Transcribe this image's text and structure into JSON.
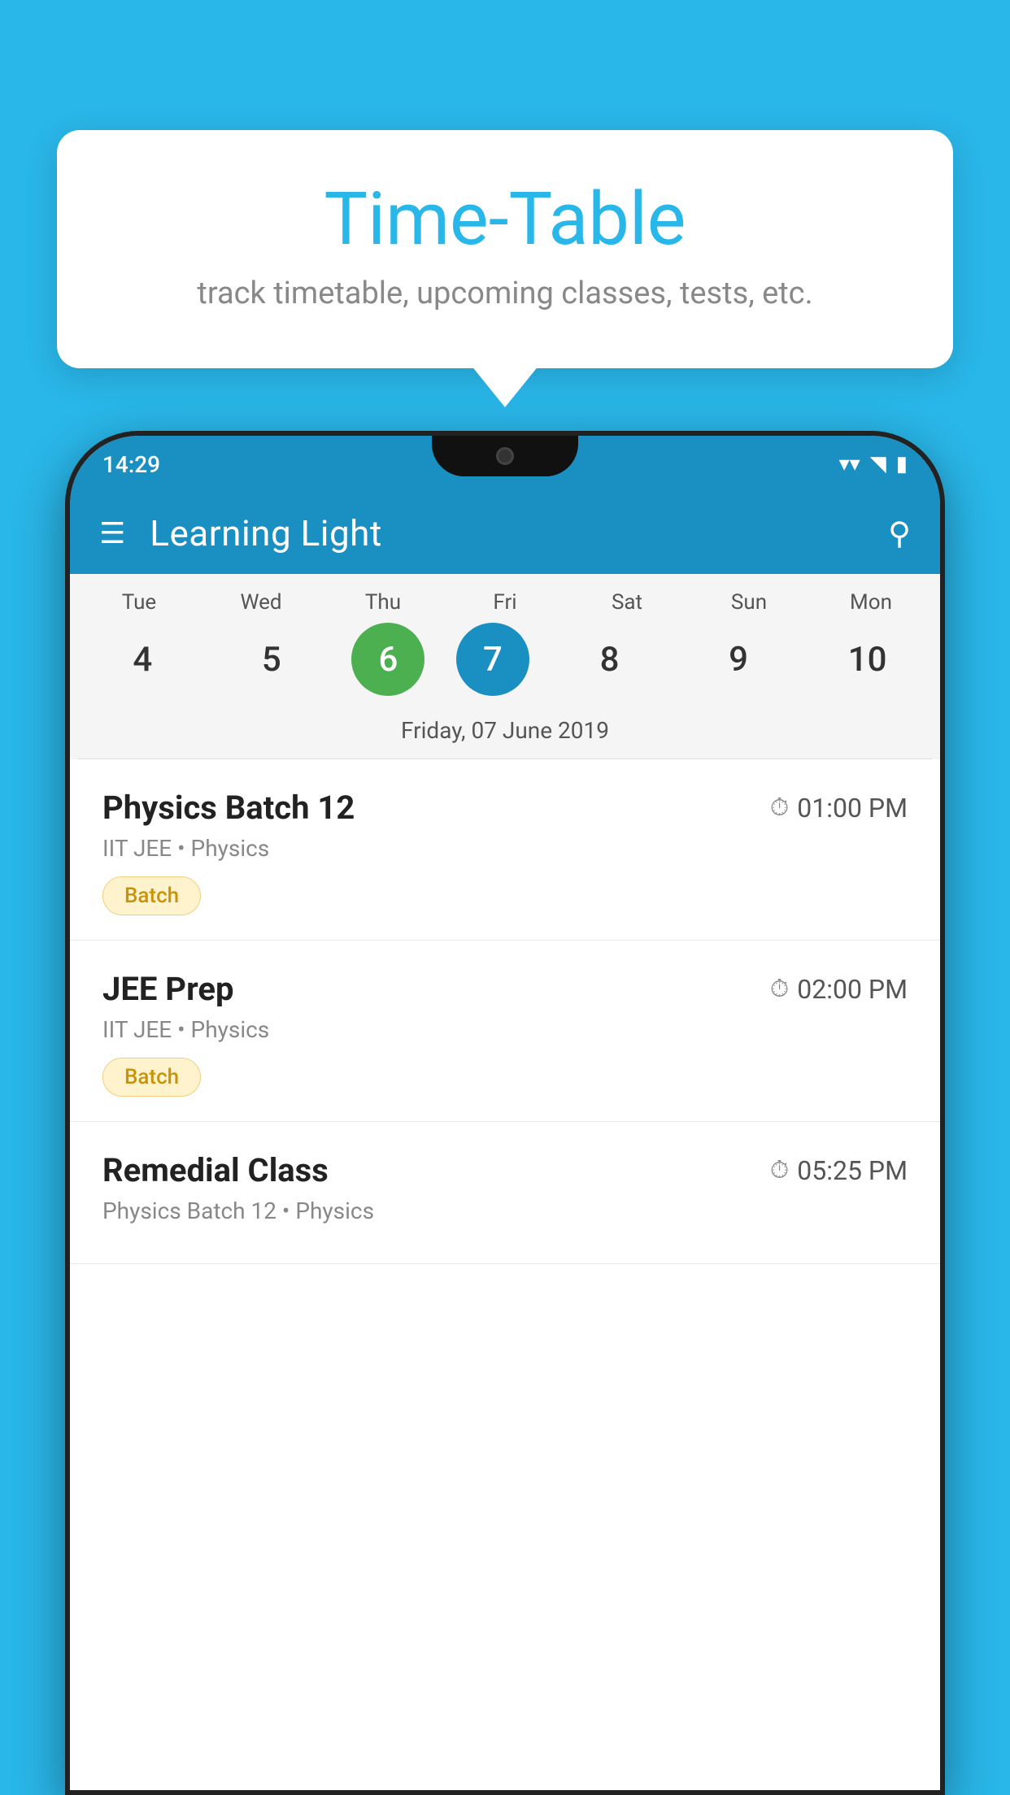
{
  "background_color": "#29b6e8",
  "tooltip": {
    "title": "Time-Table",
    "subtitle": "track timetable, upcoming classes, tests, etc."
  },
  "status_bar": {
    "time": "14:29"
  },
  "app_bar": {
    "title": "Learning Light",
    "hamburger_label": "≡",
    "search_label": "🔍"
  },
  "calendar": {
    "days": [
      {
        "label": "Tue",
        "number": "4"
      },
      {
        "label": "Wed",
        "number": "5"
      },
      {
        "label": "Thu",
        "number": "6",
        "state": "today"
      },
      {
        "label": "Fri",
        "number": "7",
        "state": "selected"
      },
      {
        "label": "Sat",
        "number": "8"
      },
      {
        "label": "Sun",
        "number": "9"
      },
      {
        "label": "Mon",
        "number": "10"
      }
    ],
    "selected_date_label": "Friday, 07 June 2019"
  },
  "schedule": [
    {
      "title": "Physics Batch 12",
      "time": "01:00 PM",
      "subtitle": "IIT JEE • Physics",
      "badge": "Batch"
    },
    {
      "title": "JEE Prep",
      "time": "02:00 PM",
      "subtitle": "IIT JEE • Physics",
      "badge": "Batch"
    },
    {
      "title": "Remedial Class",
      "time": "05:25 PM",
      "subtitle": "Physics Batch 12 • Physics",
      "badge": null
    }
  ]
}
